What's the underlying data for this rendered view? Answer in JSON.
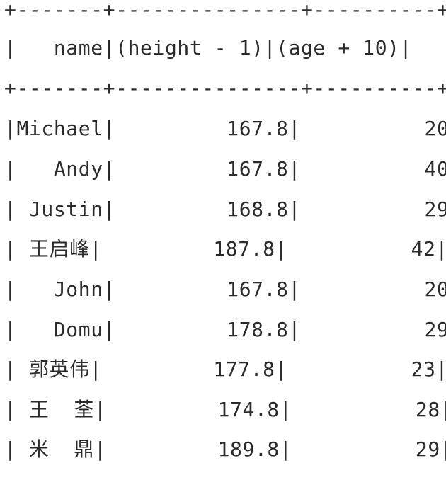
{
  "console": {
    "lines": [
      "+-------+---------------+----------+",
      "|   name|(height - 1)|(age + 10)|",
      "+-------+---------------+----------+",
      "|Michael|         167.8|          20|",
      "|   Andy|         167.8|          40|",
      "| Justin|         168.8|          29|",
      "| 王启峰|         187.8|          42|",
      "|   John|         167.8|          20|",
      "|   Domu|         178.8|          29|",
      "| 郭英伟|         177.8|          23|",
      "| 王  荃|         174.8|          28|",
      "| 米  鼎|         189.8|          29|"
    ]
  }
}
